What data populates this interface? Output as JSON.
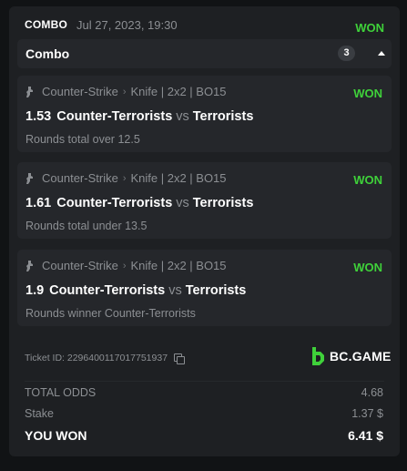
{
  "header": {
    "kind": "COMBO",
    "date": "Jul 27, 2023, 19:30",
    "status": "WON"
  },
  "combo": {
    "title": "Combo",
    "count": "3"
  },
  "legs": [
    {
      "sport": "Counter-Strike",
      "tournament": "Knife | 2x2 | BO15",
      "status": "WON",
      "odds": "1.53",
      "home": "Counter-Terrorists",
      "vs": "vs",
      "away": "Terrorists",
      "market": "Rounds total over 12.5"
    },
    {
      "sport": "Counter-Strike",
      "tournament": "Knife | 2x2 | BO15",
      "status": "WON",
      "odds": "1.61",
      "home": "Counter-Terrorists",
      "vs": "vs",
      "away": "Terrorists",
      "market": "Rounds total under 13.5"
    },
    {
      "sport": "Counter-Strike",
      "tournament": "Knife | 2x2 | BO15",
      "status": "WON",
      "odds": "1.9",
      "home": "Counter-Terrorists",
      "vs": "vs",
      "away": "Terrorists",
      "market": "Rounds winner Counter-Terrorists"
    }
  ],
  "ticket": {
    "label": "Ticket ID: 2296400117017751937"
  },
  "brand": {
    "name": "BC.GAME",
    "accent": "#3fd13a"
  },
  "summary": {
    "total_odds_label": "TOTAL ODDS",
    "total_odds_value": "4.68",
    "stake_label": "Stake",
    "stake_value": "1.37 $",
    "won_label": "YOU WON",
    "won_value": "6.41 $"
  },
  "colors": {
    "background": "#111315",
    "card": "#1e2023",
    "panel": "#25272b",
    "won_green": "#3fd13a",
    "muted_text": "#8c8f93"
  }
}
